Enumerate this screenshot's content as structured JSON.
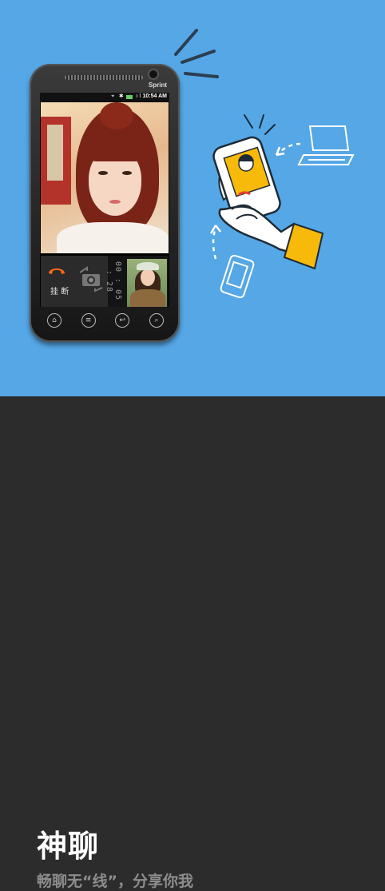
{
  "phone": {
    "brand": "Sprint",
    "status_time": "10:54 AM",
    "call": {
      "hangup_label": "挂 断",
      "timer": "00 : 05 : 28"
    },
    "nav_keys": [
      "⌂",
      "≡",
      "↩",
      "⌕"
    ]
  },
  "intro": {
    "title": "神聊",
    "subtitle": "畅聊无“线”，分享你我"
  },
  "colors": {
    "hero_bg": "#55a7e6",
    "panel_bg": "#2c2c2c",
    "accent_orange": "#ff6a14",
    "glove_yellow": "#f7b90a"
  }
}
